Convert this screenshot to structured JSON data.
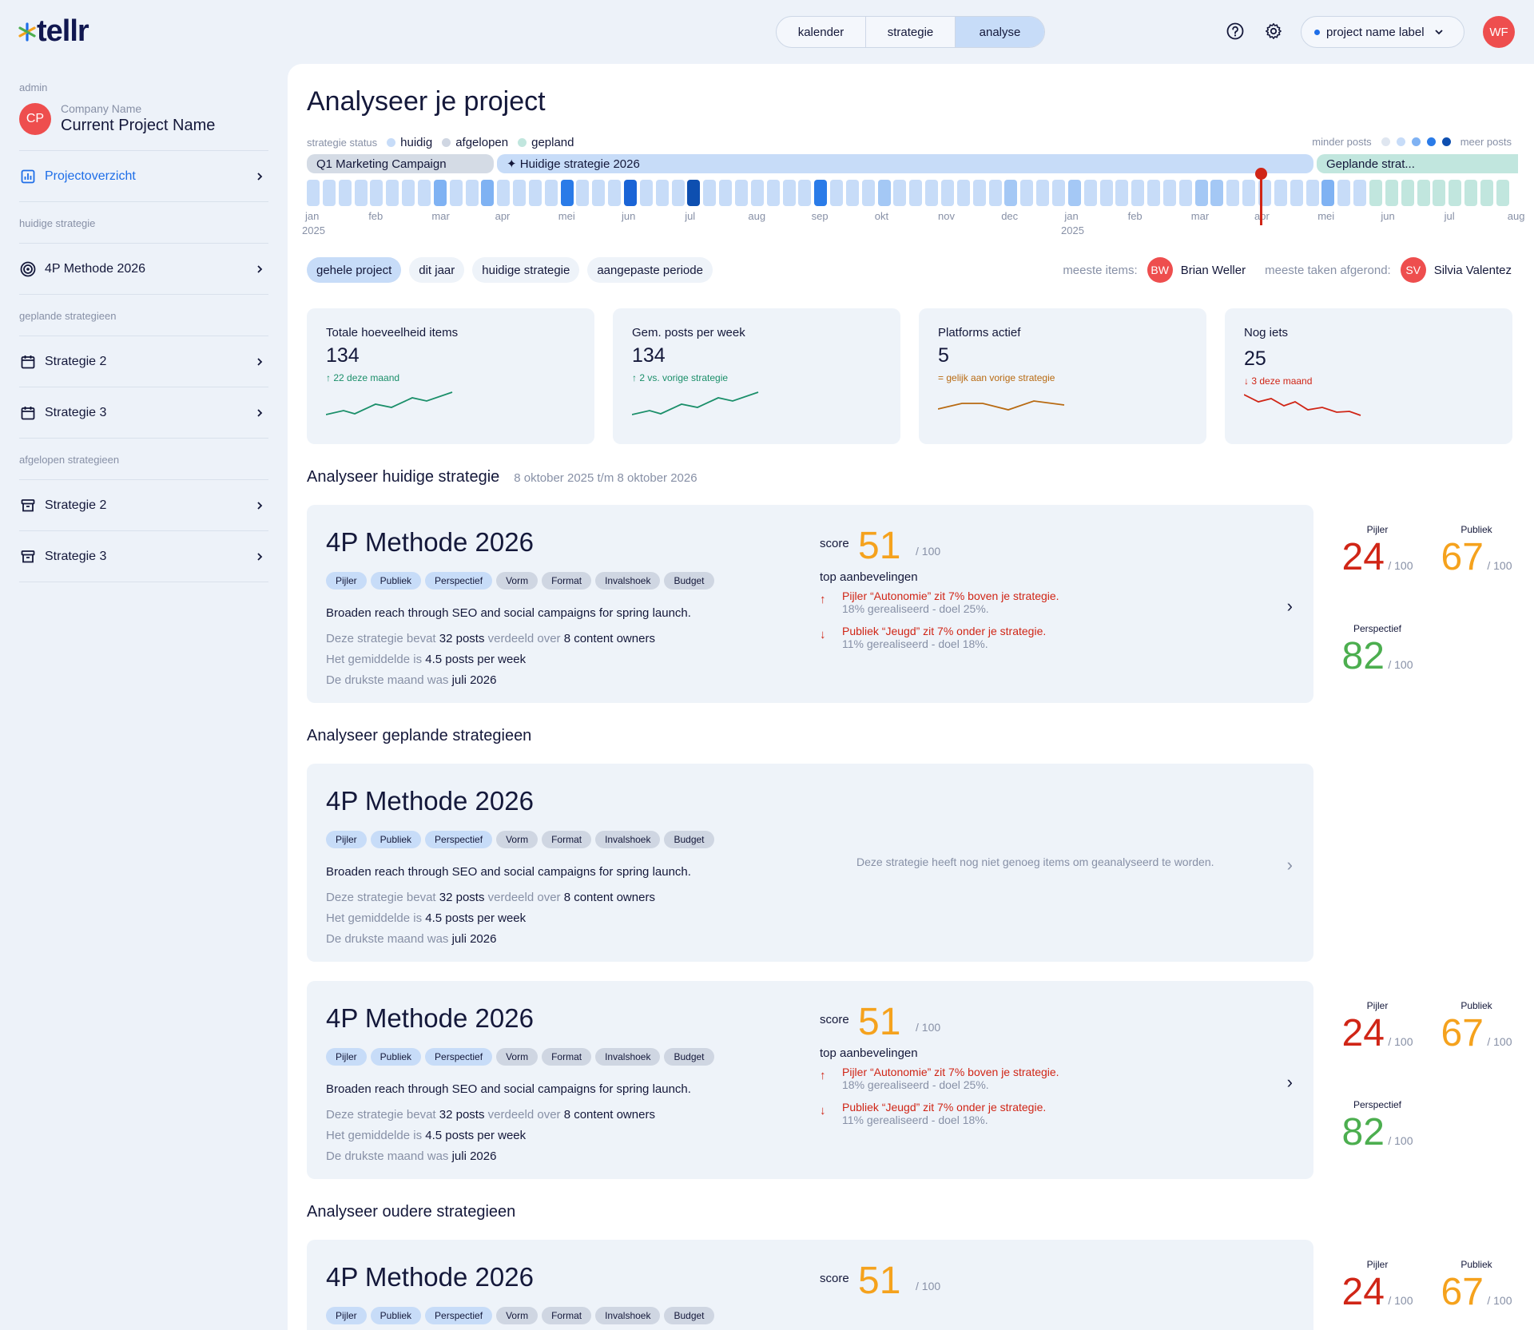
{
  "app": {
    "logo": "tellr",
    "nav_tabs": [
      "kalender",
      "strategie",
      "analyse"
    ],
    "active_tab": "analyse",
    "project_select": "project name label",
    "user_initials": "WF"
  },
  "sidebar": {
    "role": "admin",
    "company_initials": "CP",
    "company_name": "Company Name",
    "project_name": "Current Project Name",
    "overview": "Projectoverzicht",
    "sec_current": "huidige strategie",
    "current_item": "4P Methode 2026",
    "sec_planned": "geplande strategieen",
    "planned": [
      "Strategie 2",
      "Strategie 3"
    ],
    "sec_past": "afgelopen strategieen",
    "past": [
      "Strategie 2",
      "Strategie 3"
    ]
  },
  "main": {
    "title": "Analyseer je project",
    "timeline": {
      "status_label": "strategie status",
      "legend": [
        {
          "label": "huidig",
          "color": "#c7dcf8"
        },
        {
          "label": "afgelopen",
          "color": "#cfd6e2"
        },
        {
          "label": "gepland",
          "color": "#c1e6de"
        }
      ],
      "density_min": "minder posts",
      "density_max": "meer posts",
      "bars": [
        "Q1 Marketing Campaign",
        "✦ Huidige strategie 2026",
        "Geplande strat..."
      ],
      "months": [
        "jan",
        "feb",
        "mar",
        "apr",
        "mei",
        "jun",
        "jul",
        "aug",
        "sep",
        "okt",
        "nov",
        "dec",
        "jan",
        "feb",
        "mar",
        "apr",
        "mei",
        "jun",
        "jul",
        "aug"
      ],
      "years": [
        "2025",
        "2025"
      ]
    },
    "filters": [
      "gehele project",
      "dit jaar",
      "huidige strategie",
      "aangepaste periode"
    ],
    "active_filter": "gehele project",
    "most_items_label": "meeste items:",
    "most_items_initials": "BW",
    "most_items_name": "Brian Weller",
    "most_tasks_label": "meeste taken afgerond:",
    "most_tasks_initials": "SV",
    "most_tasks_name": "Silvia Valentez",
    "stats": [
      {
        "title": "Totale hoeveelheid items",
        "value": "134",
        "change": "↑ 22 deze maand",
        "trend": "up",
        "color": "#1b8f6a"
      },
      {
        "title": "Gem. posts per week",
        "value": "134",
        "change": "↑ 2 vs. vorige strategie",
        "trend": "up",
        "color": "#1b8f6a"
      },
      {
        "title": "Platforms actief",
        "value": "5",
        "change": "= gelijk aan vorige strategie",
        "trend": "flat",
        "color": "#b86a12"
      },
      {
        "title": "Nog iets",
        "value": "25",
        "change": "↓ 3 deze maand",
        "trend": "down",
        "color": "#d02516"
      }
    ],
    "sec_current": "Analyseer huidige strategie",
    "sec_current_dates": "8 oktober 2025 t/m 8 oktober 2026",
    "sec_planned": "Analyseer geplande strategieen",
    "sec_old": "Analyseer oudere strategieen",
    "card": {
      "title": "4P Methode 2026",
      "tags": [
        "Pijler",
        "Publiek",
        "Perspectief",
        "Vorm",
        "Format",
        "Invalshoek",
        "Budget"
      ],
      "description": "Broaden reach through SEO and social campaigns for spring launch.",
      "info1_a": "Deze strategie bevat",
      "info1_b": "32 posts",
      "info1_c": "verdeeld over",
      "info1_d": "8 content owners",
      "info2_a": "Het gemiddelde is",
      "info2_b": "4.5 posts per week",
      "info3_a": "De drukste maand was",
      "info3_b": "juli 2026",
      "score_label": "score",
      "score": "51",
      "score_max": "/ 100",
      "reco_title": "top aanbevelingen",
      "reco1_l1": "Pijler “Autonomie” zit 7% boven je strategie.",
      "reco1_l2": "18% gerealiseerd - doel 25%.",
      "reco2_l1": "Publiek “Jeugd” zit 7% onder je strategie.",
      "reco2_l2": "11% gerealiseerd - doel 18%.",
      "empty_msg": "Deze strategie heeft nog niet genoeg items om geanalyseerd te worden."
    },
    "pillars": [
      {
        "name": "Pijler",
        "value": "24",
        "max": "/ 100",
        "color": "#d02516"
      },
      {
        "name": "Publiek",
        "value": "67",
        "max": "/ 100",
        "color": "#f5a21d"
      },
      {
        "name": "Perspectief",
        "value": "82",
        "max": "/ 100",
        "color": "#4cae4f"
      }
    ]
  }
}
